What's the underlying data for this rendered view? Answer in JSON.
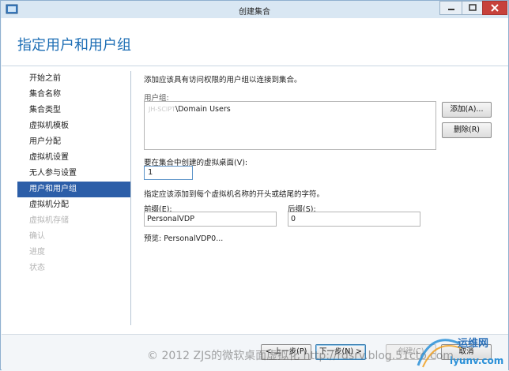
{
  "window": {
    "title": "创建集合"
  },
  "header": {
    "title": "指定用户和用户组"
  },
  "nav": {
    "items": [
      {
        "label": "开始之前",
        "state": "normal"
      },
      {
        "label": "集合名称",
        "state": "normal"
      },
      {
        "label": "集合类型",
        "state": "normal"
      },
      {
        "label": "虚拟机模板",
        "state": "normal"
      },
      {
        "label": "用户分配",
        "state": "normal"
      },
      {
        "label": "虚拟机设置",
        "state": "normal"
      },
      {
        "label": "无人参与设置",
        "state": "normal"
      },
      {
        "label": "用户和用户组",
        "state": "active"
      },
      {
        "label": "虚拟机分配",
        "state": "normal"
      },
      {
        "label": "虚拟机存储",
        "state": "disabled"
      },
      {
        "label": "确认",
        "state": "disabled"
      },
      {
        "label": "进度",
        "state": "disabled"
      },
      {
        "label": "状态",
        "state": "disabled"
      }
    ]
  },
  "main": {
    "intro": "添加应该具有访问权限的用户组以连接到集合。",
    "user_groups_label": "用户组:",
    "user_groups": [
      {
        "domain": "JH-SCIPT",
        "group": "\\Domain Users"
      }
    ],
    "add_button": "添加(A)...",
    "remove_button": "删除(R)",
    "vm_count_label": "要在集合中创建的虚拟桌面(V):",
    "vm_count_value": "1",
    "naming_hint": "指定应该添加到每个虚拟机名称的开头或结尾的字符。",
    "prefix_label": "前缀(E):",
    "prefix_value": "PersonalVDP",
    "suffix_label": "后缀(S):",
    "suffix_value": "0",
    "preview_label": "预览:",
    "preview_value": "PersonalVDP0..."
  },
  "footer": {
    "prev_button": "< 上一步(P)",
    "next_button": "下一步(N) >",
    "create_button": "创建(C)",
    "cancel_button": "取消"
  },
  "watermark": {
    "text": "© 2012 ZJS的微软桌面虚拟化 http://rdsrv.blog.51cto.com",
    "logo_text": "运维网",
    "logo_url_text": "iyunv.com"
  },
  "colors": {
    "accent": "#1d6eb5",
    "nav_active": "#2c5ea8",
    "close_button": "#c7413b"
  },
  "icons": [
    "app-icon",
    "minimize-icon",
    "maximize-icon",
    "close-icon"
  ]
}
